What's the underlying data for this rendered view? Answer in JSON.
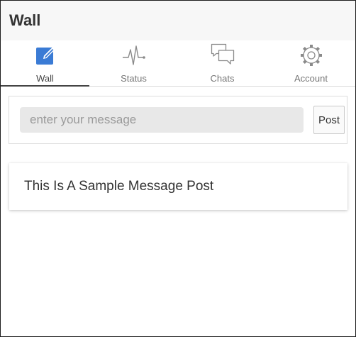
{
  "header": {
    "title": "Wall"
  },
  "tabs": [
    {
      "label": "Wall",
      "icon": "edit-icon",
      "active": true
    },
    {
      "label": "Status",
      "icon": "pulse-icon",
      "active": false
    },
    {
      "label": "Chats",
      "icon": "chat-bubbles-icon",
      "active": false
    },
    {
      "label": "Account",
      "icon": "gear-icon",
      "active": false
    }
  ],
  "composer": {
    "placeholder": "enter your message",
    "value": "",
    "post_label": "Post"
  },
  "posts": [
    {
      "text": "This Is A Sample Message Post"
    }
  ],
  "colors": {
    "active_icon": "#3a7bd5",
    "inactive_icon": "#8a8a8a",
    "header_bg": "#f7f7f7"
  }
}
